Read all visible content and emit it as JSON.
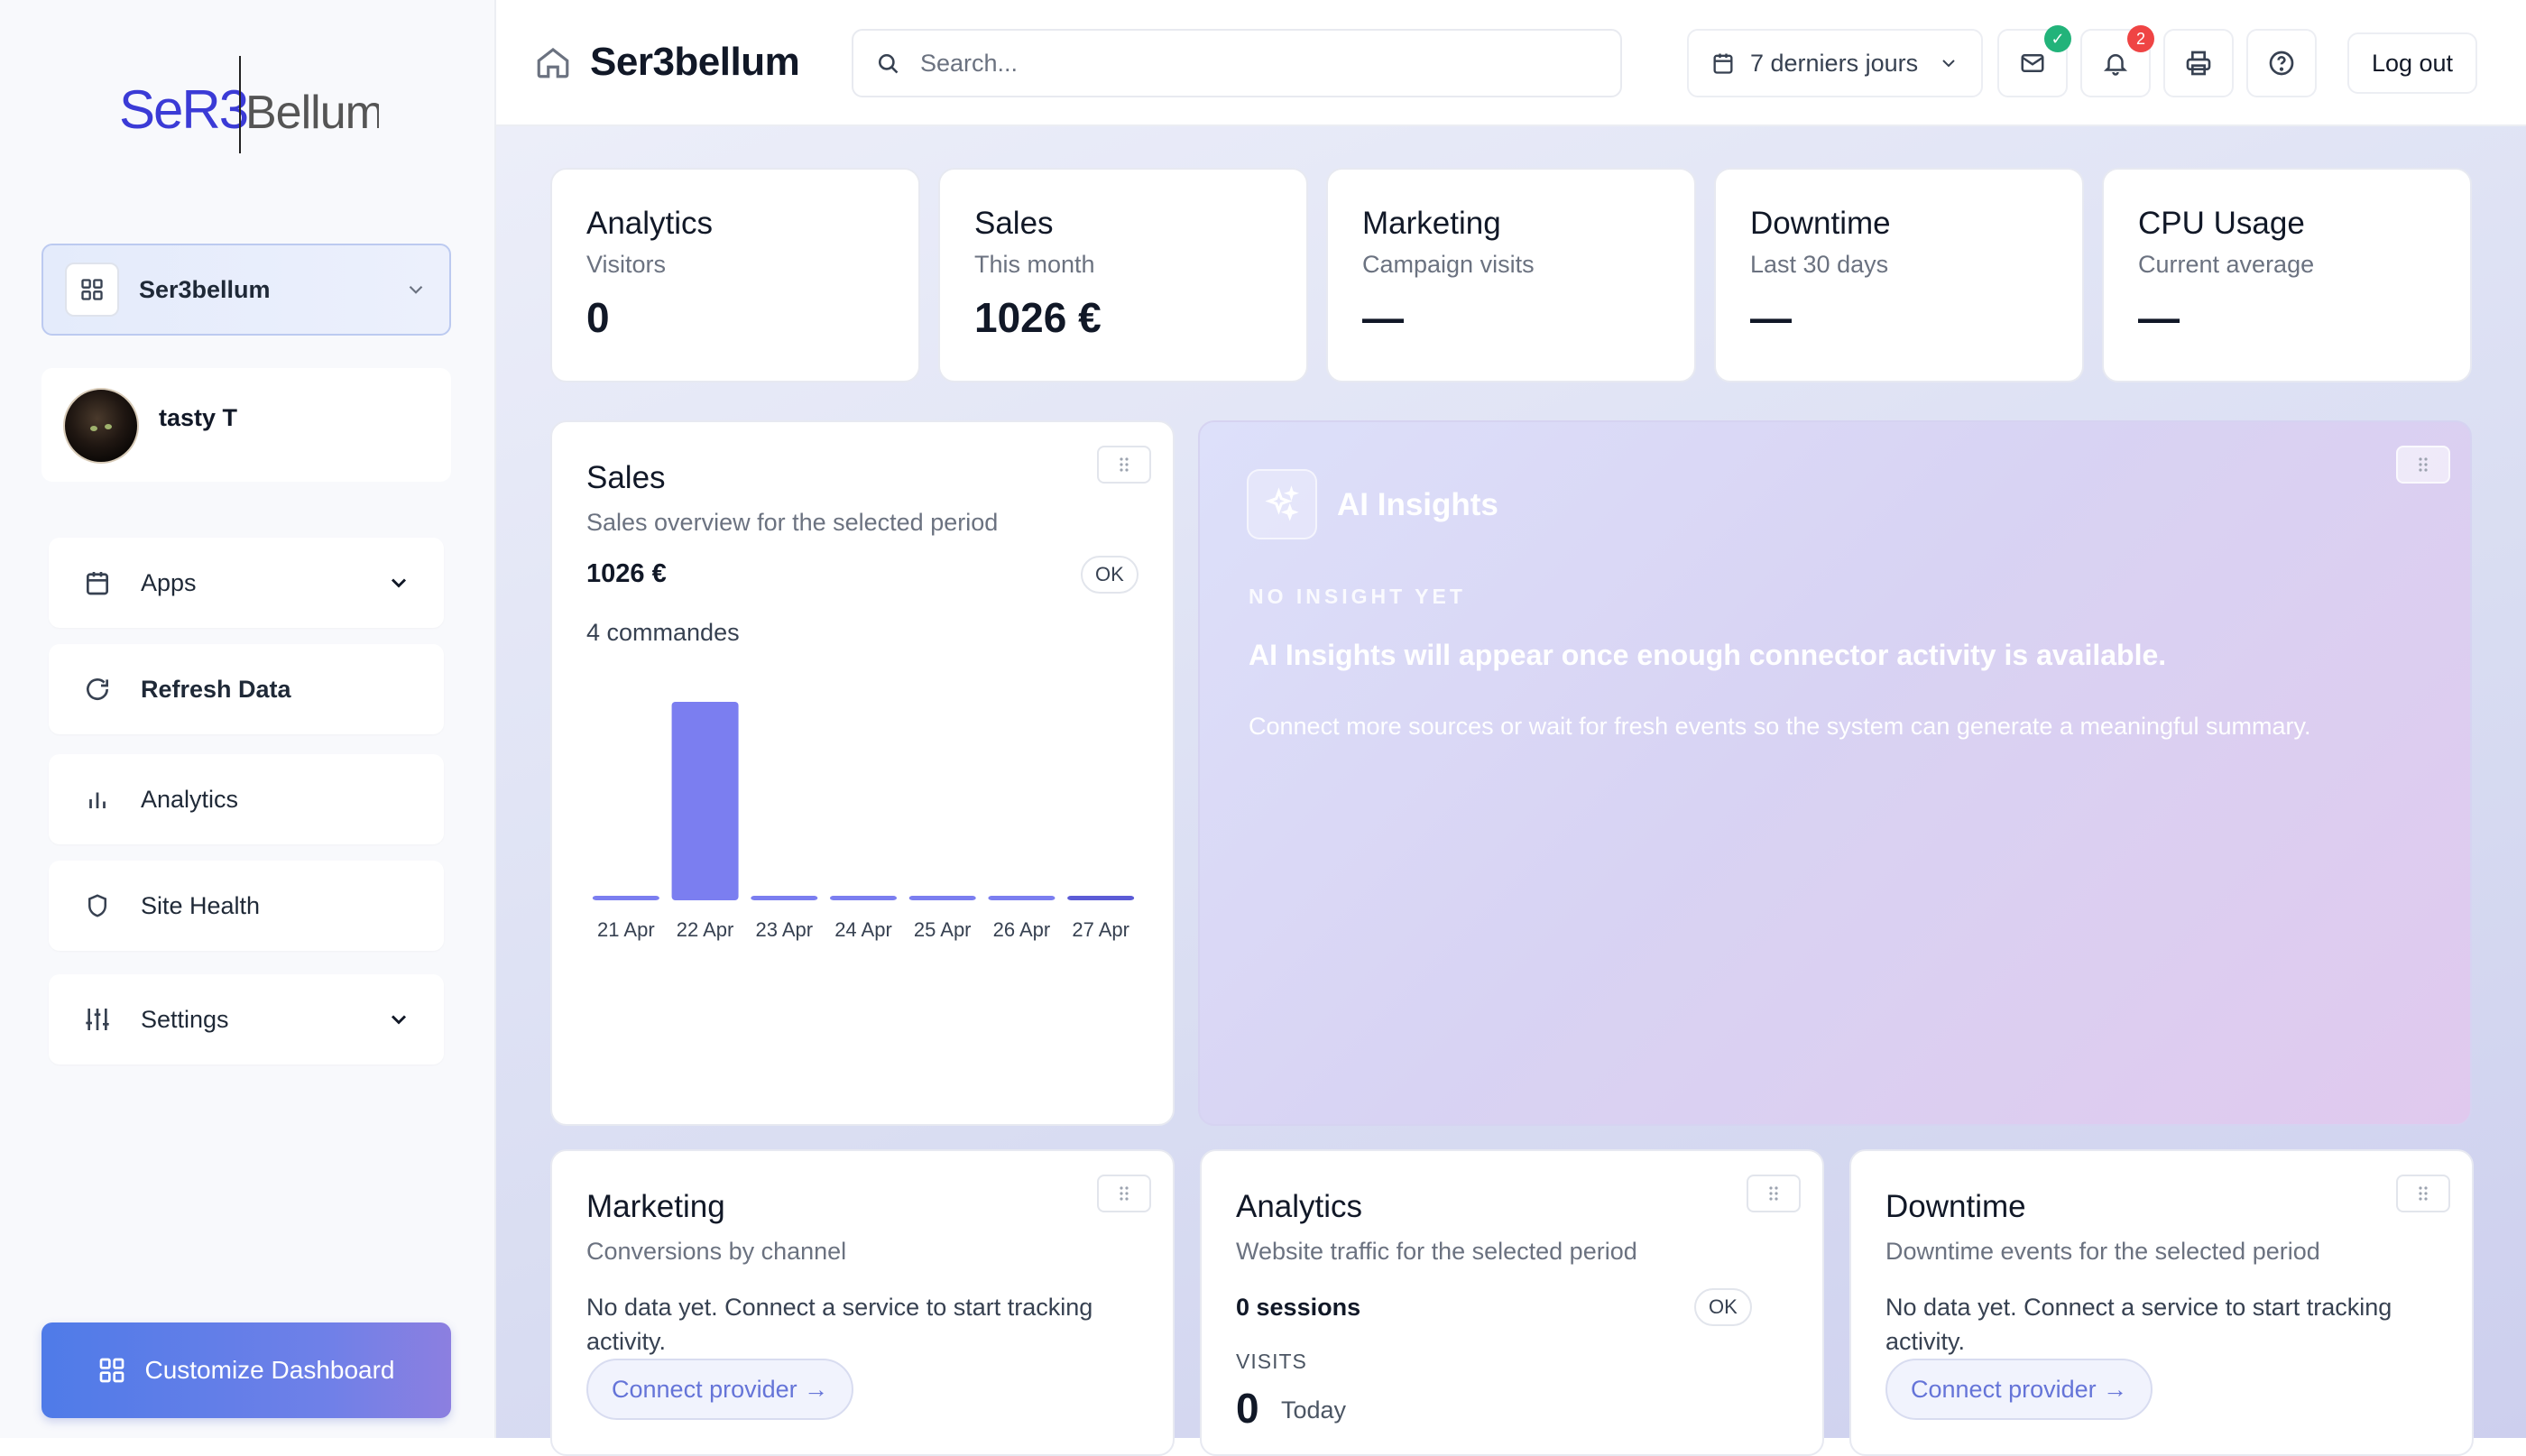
{
  "logo": {
    "text_left": "SeR3",
    "text_right": "Bellum"
  },
  "sidebar": {
    "workspace": "Ser3bellum",
    "user": "tasty T",
    "items": [
      {
        "label": "Apps",
        "icon": "calendar-icon",
        "expandable": true
      },
      {
        "label": "Refresh Data",
        "icon": "refresh-icon",
        "expandable": false
      },
      {
        "label": "Analytics",
        "icon": "bar-chart-icon",
        "expandable": false
      },
      {
        "label": "Site Health",
        "icon": "shield-icon",
        "expandable": false
      },
      {
        "label": "Settings",
        "icon": "sliders-icon",
        "expandable": true
      }
    ],
    "customize_label": "Customize Dashboard"
  },
  "header": {
    "title": "Ser3bellum",
    "search_placeholder": "Search...",
    "date_range": "7 derniers jours",
    "mail_badge": "✓",
    "notifications_badge": "2",
    "logout_label": "Log out"
  },
  "stats": [
    {
      "title": "Analytics",
      "subtitle": "Visitors",
      "value": "0"
    },
    {
      "title": "Sales",
      "subtitle": "This month",
      "value": "1026 €"
    },
    {
      "title": "Marketing",
      "subtitle": "Campaign visits",
      "value": "—"
    },
    {
      "title": "Downtime",
      "subtitle": "Last 30 days",
      "value": "—"
    },
    {
      "title": "CPU Usage",
      "subtitle": "Current average",
      "value": "—"
    }
  ],
  "sales_card": {
    "title": "Sales",
    "subtitle": "Sales overview for the selected period",
    "total": "1026 €",
    "status": "OK",
    "orders": "4 commandes"
  },
  "chart_data": {
    "type": "bar",
    "categories": [
      "21 Apr",
      "22 Apr",
      "23 Apr",
      "24 Apr",
      "25 Apr",
      "26 Apr",
      "27 Apr"
    ],
    "values": [
      0,
      1026,
      0,
      0,
      0,
      0,
      0
    ],
    "title": "",
    "xlabel": "",
    "ylabel": "",
    "grid": false,
    "colors": {
      "bar": "#7b7ef0",
      "last_bar": "#5b5bd6"
    }
  },
  "ai_card": {
    "title": "AI Insights",
    "kicker": "NO INSIGHT YET",
    "headline": "AI Insights will appear once enough connector activity is available.",
    "body": "Connect more sources or wait for fresh events so the system can generate a meaningful summary."
  },
  "marketing_card": {
    "title": "Marketing",
    "subtitle": "Conversions by channel",
    "message": "No data yet. Connect a service to start tracking activity.",
    "cta": "Connect provider →"
  },
  "analytics_card": {
    "title": "Analytics",
    "subtitle": "Website traffic for the selected period",
    "sessions": "0 sessions",
    "status": "OK",
    "visits_label": "VISITS",
    "visits_value": "0",
    "visits_period": "Today"
  },
  "downtime_card": {
    "title": "Downtime",
    "subtitle": "Downtime events for the selected period",
    "message": "No data yet. Connect a service to start tracking activity.",
    "cta": "Connect provider →"
  },
  "colors": {
    "accent": "#6574d8",
    "primary_button": "#4f7be8",
    "badge_green": "#22b37a",
    "badge_red": "#ef4444"
  }
}
